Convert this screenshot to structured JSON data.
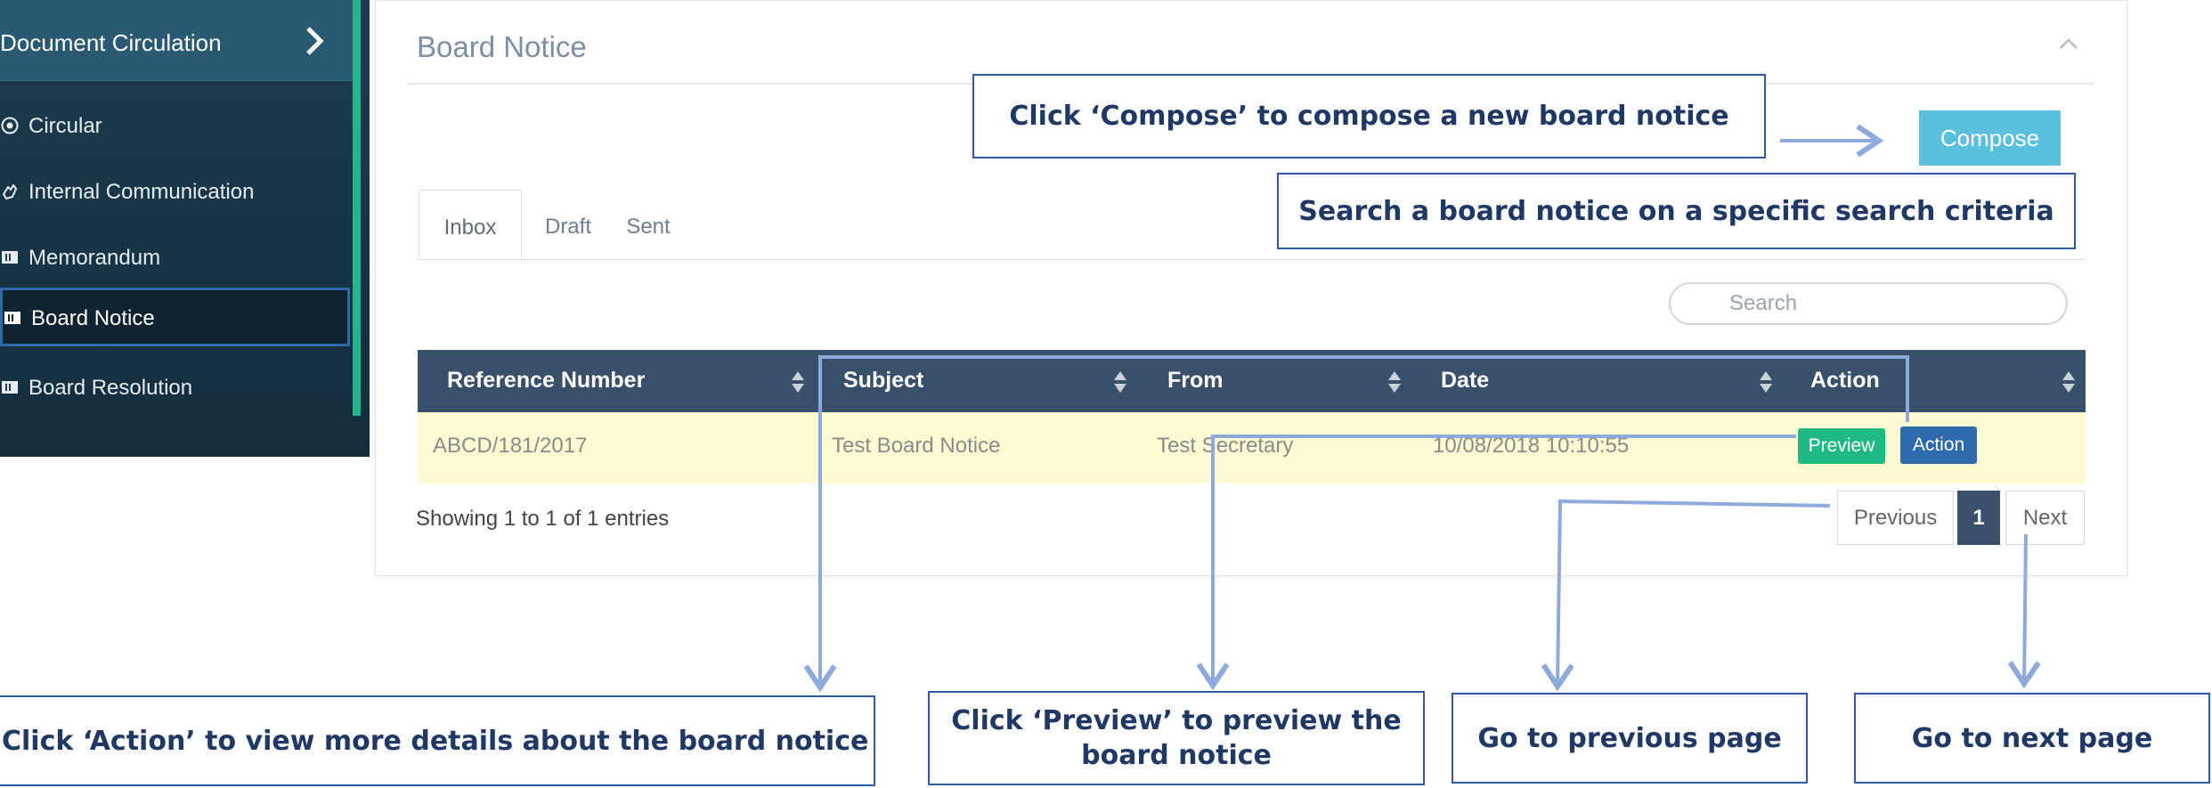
{
  "sidebar": {
    "title": "Document Circulation",
    "items": [
      {
        "label": "Circular",
        "icon": "radio-dot-icon"
      },
      {
        "label": "Internal Communication",
        "icon": "hand-icon"
      },
      {
        "label": "Memorandum",
        "icon": "document-icon"
      },
      {
        "label": "Board Notice",
        "icon": "document-icon",
        "active": true
      },
      {
        "label": "Board Resolution",
        "icon": "document-icon"
      }
    ]
  },
  "panel": {
    "title": "Board Notice",
    "compose_label": "Compose",
    "tabs": [
      {
        "label": "Inbox",
        "active": true
      },
      {
        "label": "Draft"
      },
      {
        "label": "Sent"
      }
    ],
    "search_placeholder": "Search",
    "table": {
      "columns": [
        "Reference Number",
        "Subject",
        "From",
        "Date",
        "Action"
      ],
      "rows": [
        {
          "reference_number": "ABCD/181/2017",
          "subject": "Test Board Notice",
          "from": "Test Secretary",
          "date": "10/08/2018 10:10:55",
          "preview_label": "Preview",
          "action_label": "Action"
        }
      ]
    },
    "info": "Showing 1 to 1 of 1 entries",
    "pagination": {
      "previous": "Previous",
      "current": "1",
      "next": "Next"
    }
  },
  "annotations": {
    "compose": "Click  ‘Compose’ to compose a  new board notice",
    "search": "Search a board notice on a specific search criteria",
    "action": "Click  ‘Action’ to view more details about the board notice",
    "preview_line1": "Click  ‘Preview’ to preview the",
    "preview_line2": "board notice",
    "previous": "Go to previous  page",
    "next": "Go to next page"
  },
  "colors": {
    "sidebar_bg": "#1f3d4f",
    "sidebar_accent": "#24b58c",
    "table_header": "#38506a",
    "row_highlight": "#fefbd2",
    "compose_button": "#5bc0de",
    "preview_button": "#1fba84",
    "action_button": "#2f6aac",
    "callout_border": "#2f5aa0",
    "arrow": "#8eaadb"
  }
}
